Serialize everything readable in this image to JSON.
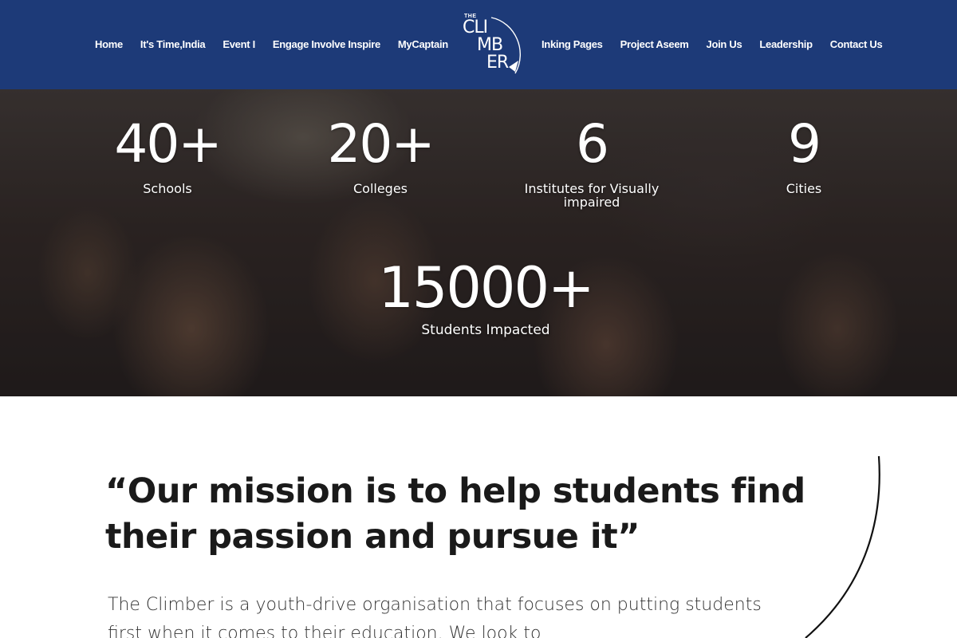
{
  "header": {
    "nav_left": [
      "Home",
      "It's Time,India",
      "Event I",
      "Engage Involve Inspire",
      "MyCaptain"
    ],
    "nav_right": [
      "Inking Pages",
      "Project Aseem",
      "Join Us",
      "Leadership",
      "Contact Us"
    ],
    "logo": {
      "small": "THE",
      "line1": "CLI",
      "line2": "MB",
      "line3": "ER"
    },
    "bg_color": "#1d3a78"
  },
  "stats": {
    "schools": {
      "value": "40+",
      "label": "Schools"
    },
    "colleges": {
      "value": "20+",
      "label": "Colleges"
    },
    "institutes": {
      "value": "6",
      "label": "Institutes for Visually impaired"
    },
    "cities": {
      "value": "9",
      "label": "Cities"
    },
    "students": {
      "value": "15000+",
      "label": "Students Impacted"
    }
  },
  "mission": {
    "quote": "“Our mission is to help students find their passion and pursue it”",
    "body": "The Climber is a youth-drive organisation that focuses on putting students first when it comes to their education. We look to"
  }
}
